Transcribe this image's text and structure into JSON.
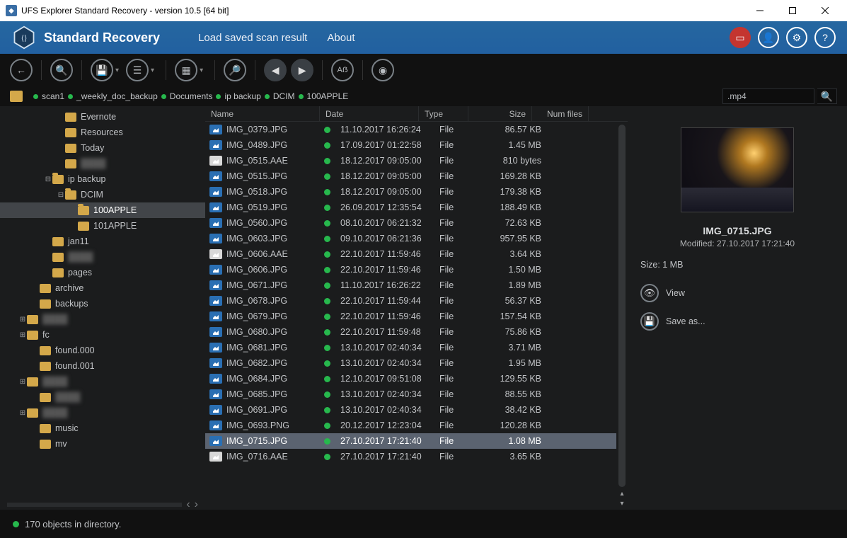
{
  "titlebar": "UFS Explorer Standard Recovery - version 10.5 [64 bit]",
  "app_title": "Standard Recovery",
  "menu": {
    "load": "Load saved scan result",
    "about": "About"
  },
  "path": [
    "scan1",
    "_weekly_doc_backup",
    "Documents",
    "ip backup",
    "DCIM",
    "100APPLE"
  ],
  "search_value": ".mp4",
  "columns": {
    "name": "Name",
    "date": "Date",
    "type": "Type",
    "size": "Size",
    "num": "Num files"
  },
  "tree": [
    {
      "d": 4,
      "t": "",
      "l": "Evernote"
    },
    {
      "d": 4,
      "t": "",
      "l": "Resources"
    },
    {
      "d": 4,
      "t": "",
      "l": "Today"
    },
    {
      "d": 4,
      "t": "",
      "l": "",
      "masked": true
    },
    {
      "d": 3,
      "t": "-",
      "l": "ip backup",
      "open": true
    },
    {
      "d": 4,
      "t": "-",
      "l": "DCIM",
      "open": true
    },
    {
      "d": 5,
      "t": "",
      "l": "100APPLE",
      "sel": true,
      "open": true
    },
    {
      "d": 5,
      "t": "",
      "l": "101APPLE"
    },
    {
      "d": 3,
      "t": "",
      "l": "jan11"
    },
    {
      "d": 3,
      "t": "",
      "l": "",
      "masked": true
    },
    {
      "d": 3,
      "t": "",
      "l": "pages"
    },
    {
      "d": 2,
      "t": "",
      "l": "archive"
    },
    {
      "d": 2,
      "t": "",
      "l": "backups"
    },
    {
      "d": 1,
      "t": "+",
      "l": "",
      "masked": true
    },
    {
      "d": 1,
      "t": "+",
      "l": "fc"
    },
    {
      "d": 2,
      "t": "",
      "l": "found.000"
    },
    {
      "d": 2,
      "t": "",
      "l": "found.001"
    },
    {
      "d": 1,
      "t": "+",
      "l": "",
      "masked": true
    },
    {
      "d": 2,
      "t": "",
      "l": "",
      "masked": true
    },
    {
      "d": 1,
      "t": "+",
      "l": "",
      "masked": true
    },
    {
      "d": 2,
      "t": "",
      "l": "music"
    },
    {
      "d": 2,
      "t": "",
      "l": "mv"
    }
  ],
  "files": [
    {
      "n": "IMG_0379.JPG",
      "d": "11.10.2017 16:26:24",
      "t": "File",
      "s": "86.57 KB",
      "k": "img"
    },
    {
      "n": "IMG_0489.JPG",
      "d": "17.09.2017 01:22:58",
      "t": "File",
      "s": "1.45 MB",
      "k": "img"
    },
    {
      "n": "IMG_0515.AAE",
      "d": "18.12.2017 09:05:00",
      "t": "File",
      "s": "810 bytes",
      "k": "doc"
    },
    {
      "n": "IMG_0515.JPG",
      "d": "18.12.2017 09:05:00",
      "t": "File",
      "s": "169.28 KB",
      "k": "img"
    },
    {
      "n": "IMG_0518.JPG",
      "d": "18.12.2017 09:05:00",
      "t": "File",
      "s": "179.38 KB",
      "k": "img"
    },
    {
      "n": "IMG_0519.JPG",
      "d": "26.09.2017 12:35:54",
      "t": "File",
      "s": "188.49 KB",
      "k": "img"
    },
    {
      "n": "IMG_0560.JPG",
      "d": "08.10.2017 06:21:32",
      "t": "File",
      "s": "72.63 KB",
      "k": "img"
    },
    {
      "n": "IMG_0603.JPG",
      "d": "09.10.2017 06:21:36",
      "t": "File",
      "s": "957.95 KB",
      "k": "img"
    },
    {
      "n": "IMG_0606.AAE",
      "d": "22.10.2017 11:59:46",
      "t": "File",
      "s": "3.64 KB",
      "k": "doc"
    },
    {
      "n": "IMG_0606.JPG",
      "d": "22.10.2017 11:59:46",
      "t": "File",
      "s": "1.50 MB",
      "k": "img"
    },
    {
      "n": "IMG_0671.JPG",
      "d": "11.10.2017 16:26:22",
      "t": "File",
      "s": "1.89 MB",
      "k": "img"
    },
    {
      "n": "IMG_0678.JPG",
      "d": "22.10.2017 11:59:44",
      "t": "File",
      "s": "56.37 KB",
      "k": "img"
    },
    {
      "n": "IMG_0679.JPG",
      "d": "22.10.2017 11:59:46",
      "t": "File",
      "s": "157.54 KB",
      "k": "img"
    },
    {
      "n": "IMG_0680.JPG",
      "d": "22.10.2017 11:59:48",
      "t": "File",
      "s": "75.86 KB",
      "k": "img"
    },
    {
      "n": "IMG_0681.JPG",
      "d": "13.10.2017 02:40:34",
      "t": "File",
      "s": "3.71 MB",
      "k": "img"
    },
    {
      "n": "IMG_0682.JPG",
      "d": "13.10.2017 02:40:34",
      "t": "File",
      "s": "1.95 MB",
      "k": "img"
    },
    {
      "n": "IMG_0684.JPG",
      "d": "12.10.2017 09:51:08",
      "t": "File",
      "s": "129.55 KB",
      "k": "img"
    },
    {
      "n": "IMG_0685.JPG",
      "d": "13.10.2017 02:40:34",
      "t": "File",
      "s": "88.55 KB",
      "k": "img"
    },
    {
      "n": "IMG_0691.JPG",
      "d": "13.10.2017 02:40:34",
      "t": "File",
      "s": "38.42 KB",
      "k": "img"
    },
    {
      "n": "IMG_0693.PNG",
      "d": "20.12.2017 12:23:04",
      "t": "File",
      "s": "120.28 KB",
      "k": "img"
    },
    {
      "n": "IMG_0715.JPG",
      "d": "27.10.2017 17:21:40",
      "t": "File",
      "s": "1.08 MB",
      "k": "img",
      "sel": true
    },
    {
      "n": "IMG_0716.AAE",
      "d": "27.10.2017 17:21:40",
      "t": "File",
      "s": "3.65 KB",
      "k": "doc"
    }
  ],
  "preview": {
    "name": "IMG_0715.JPG",
    "modified": "Modified: 27.10.2017 17:21:40",
    "size": "Size: 1 MB",
    "view": "View",
    "saveas": "Save as..."
  },
  "status": "170 objects in directory."
}
